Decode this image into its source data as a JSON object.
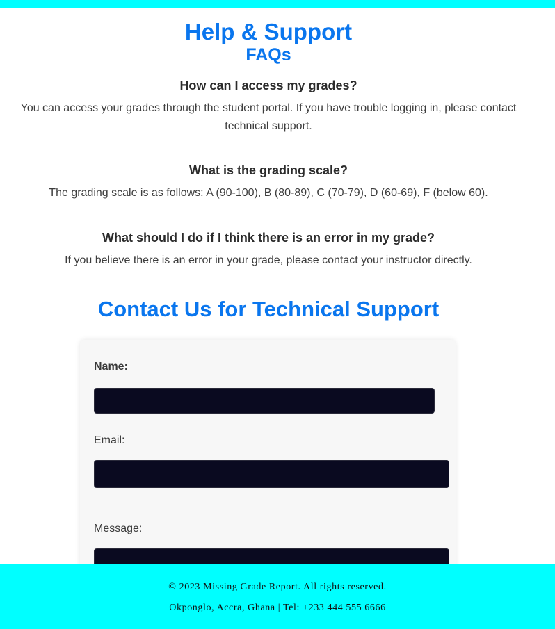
{
  "header": {
    "title": "Help & Support",
    "faq_heading": "FAQs"
  },
  "faqs": [
    {
      "question": "How can I access my grades?",
      "answer_line1": "You can access your grades through the student portal. If you have trouble logging in, please contact",
      "answer_line2": "technical support."
    },
    {
      "question": "What is the grading scale?",
      "answer_line1": "The grading scale is as follows: A (90-100), B (80-89), C (70-79), D (60-69), F (below 60)."
    },
    {
      "question": "What should I do if I think there is an error in my grade?",
      "answer_line1": "If you believe there is an error in your grade, please contact your instructor directly."
    }
  ],
  "contact": {
    "title": "Contact Us for Technical Support",
    "name_label": "Name:",
    "name_value": "",
    "email_label": "Email:",
    "email_value": "",
    "message_label": "Message:",
    "message_value": ""
  },
  "footer": {
    "copyright": "© 2023 Missing Grade Report. All rights reserved.",
    "address": "Okponglo, Accra, Ghana | Tel: +233 444 555 6666"
  },
  "colors": {
    "accent": "#0a76ee",
    "bar": "#00ffff",
    "input_bg": "#0a0a20"
  }
}
